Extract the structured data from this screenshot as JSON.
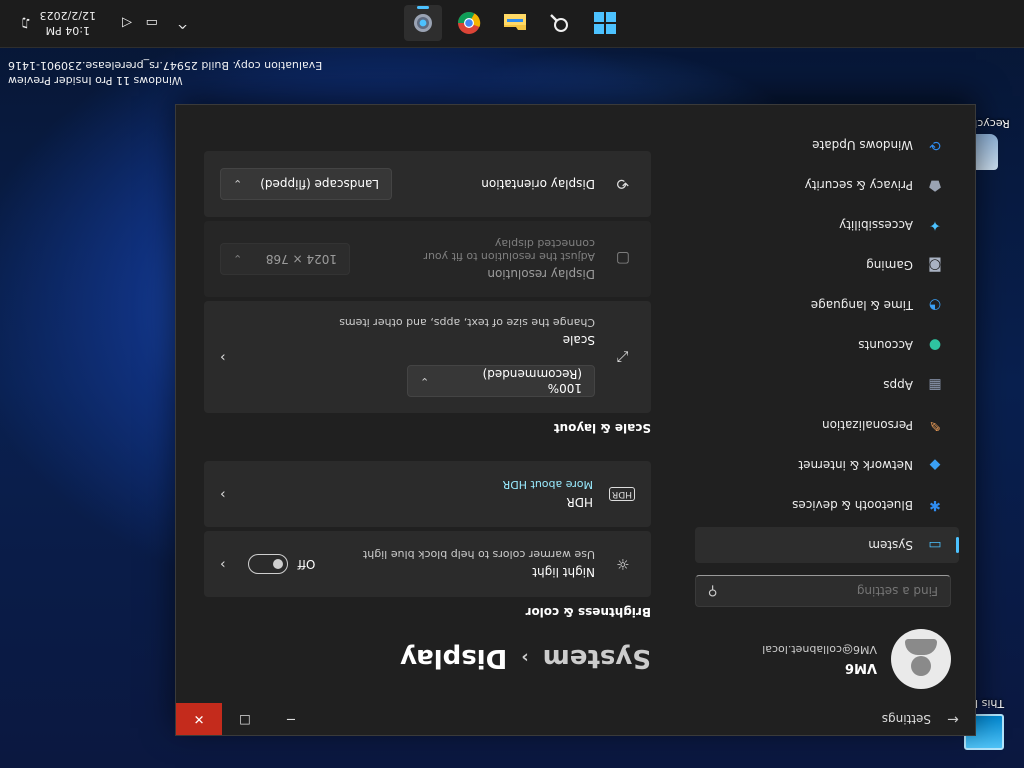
{
  "desktop": {
    "icons": [
      {
        "label": "This PC",
        "icon": "this-pc-icon"
      },
      {
        "label": "Recycle Bin",
        "icon": "recycle-bin-icon"
      }
    ],
    "watermark": {
      "line1": "Windows 11 Pro Insider Preview",
      "line2": "Evaluation copy. Build 25947.rs_prerelease.230901-1416"
    }
  },
  "window": {
    "title": "Settings",
    "back_glyph": "←",
    "minimize_glyph": "─",
    "maximize_glyph": "☐",
    "close_glyph": "✕"
  },
  "profile": {
    "name": "VM6",
    "email": "VM6@collabnet.local"
  },
  "search": {
    "placeholder": "Find a setting",
    "icon_glyph": "⚲"
  },
  "nav": {
    "items": [
      {
        "label": "System",
        "icon": "system-icon",
        "glyph": "▭",
        "color": "#4cc2ff",
        "active": true
      },
      {
        "label": "Bluetooth & devices",
        "icon": "bluetooth-icon",
        "glyph": "✱",
        "color": "#2f8cf0",
        "active": false
      },
      {
        "label": "Network & internet",
        "icon": "network-icon",
        "glyph": "◆",
        "color": "#3aa0f5",
        "active": false
      },
      {
        "label": "Personalization",
        "icon": "personalization-icon",
        "glyph": "✎",
        "color": "#f0a05a",
        "active": false
      },
      {
        "label": "Apps",
        "icon": "apps-icon",
        "glyph": "▦",
        "color": "#8e9ab3",
        "active": false
      },
      {
        "label": "Accounts",
        "icon": "accounts-icon",
        "glyph": "●",
        "color": "#2ec4a0",
        "active": false
      },
      {
        "label": "Time & language",
        "icon": "time-language-icon",
        "glyph": "◔",
        "color": "#3aa0f5",
        "active": false
      },
      {
        "label": "Gaming",
        "icon": "gaming-icon",
        "glyph": "◙",
        "color": "#a9b2c2",
        "active": false
      },
      {
        "label": "Accessibility",
        "icon": "accessibility-icon",
        "glyph": "✦",
        "color": "#4cc2ff",
        "active": false
      },
      {
        "label": "Privacy & security",
        "icon": "privacy-shield-icon",
        "glyph": "⬟",
        "color": "#9aa3b3",
        "active": false
      },
      {
        "label": "Windows Update",
        "icon": "windows-update-icon",
        "glyph": "⟳",
        "color": "#2f8cf0",
        "active": false
      }
    ]
  },
  "content": {
    "breadcrumb_parent": "System",
    "breadcrumb_sep": "›",
    "breadcrumb_current": "Display",
    "brightness_section": "Brightness & color",
    "night_light": {
      "title": "Night light",
      "subtitle": "Use warmer colors to help block blue light",
      "toggle_state": "Off",
      "icon_glyph": "☼"
    },
    "hdr": {
      "title": "HDR",
      "link": "More about HDR",
      "icon_glyph": "HDR"
    },
    "scale_section": "Scale & layout",
    "scale": {
      "title": "Scale",
      "subtitle": "Change the size of text, apps, and other items",
      "value": "100% (Recommended)",
      "icon_glyph": "⤢"
    },
    "resolution": {
      "title": "Display resolution",
      "subtitle": "Adjust the resolution to fit your connected display",
      "value": "1024 × 768",
      "icon_glyph": "▢"
    },
    "orientation": {
      "title": "Display orientation",
      "value": "Landscape (flipped)",
      "icon_glyph": "⟲"
    },
    "chevron_glyph": "›",
    "dropdown_glyph": "⌄"
  },
  "taskbar": {
    "apps": [
      {
        "name": "Start",
        "icon": "windows-start-icon"
      },
      {
        "name": "Search",
        "icon": "search-icon"
      },
      {
        "name": "File Explorer",
        "icon": "file-explorer-icon"
      },
      {
        "name": "Google Chrome",
        "icon": "chrome-icon"
      },
      {
        "name": "Settings",
        "icon": "settings-gear-icon",
        "active": true
      }
    ],
    "tray": {
      "chevron_glyph": "^",
      "network_glyph": "▭",
      "volume_glyph": "◁",
      "time": "1:04 PM",
      "date": "12/2/2023",
      "bell_glyph": "♫"
    }
  }
}
